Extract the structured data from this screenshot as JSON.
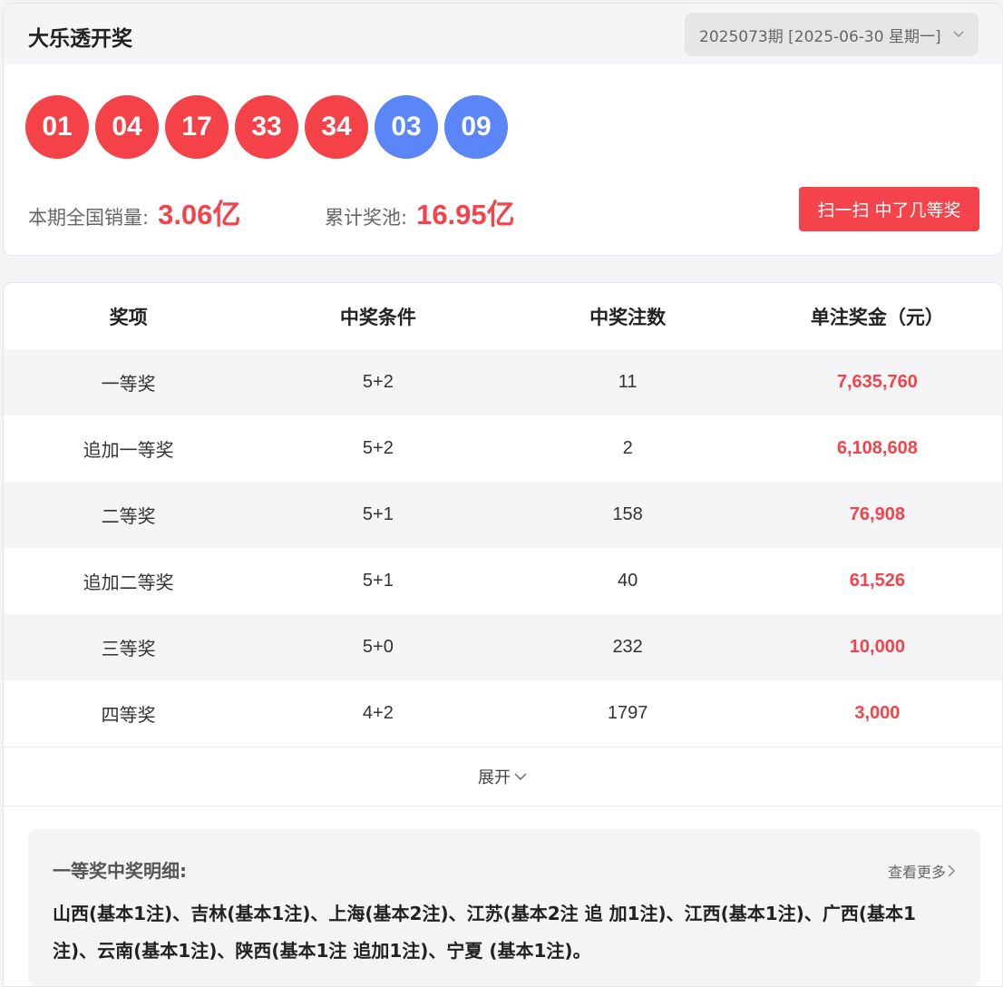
{
  "header": {
    "title": "大乐透开奖",
    "issue_select": "2025073期 [2025-06-30 星期一]"
  },
  "balls": {
    "red": [
      "01",
      "04",
      "17",
      "33",
      "34"
    ],
    "blue": [
      "03",
      "09"
    ]
  },
  "stats": {
    "sales_label": "本期全国销量:",
    "sales_value": "3.06亿",
    "pool_label": "累计奖池:",
    "pool_value": "16.95亿"
  },
  "scan_button": "扫一扫 中了几等奖",
  "table": {
    "headers": [
      "奖项",
      "中奖条件",
      "中奖注数",
      "单注奖金（元）"
    ],
    "rows": [
      {
        "name": "一等奖",
        "cond": "5+2",
        "count": "11",
        "prize": "7,635,760"
      },
      {
        "name": "追加一等奖",
        "cond": "5+2",
        "count": "2",
        "prize": "6,108,608"
      },
      {
        "name": "二等奖",
        "cond": "5+1",
        "count": "158",
        "prize": "76,908"
      },
      {
        "name": "追加二等奖",
        "cond": "5+1",
        "count": "40",
        "prize": "61,526"
      },
      {
        "name": "三等奖",
        "cond": "5+0",
        "count": "232",
        "prize": "10,000"
      },
      {
        "name": "四等奖",
        "cond": "4+2",
        "count": "1797",
        "prize": "3,000"
      }
    ]
  },
  "expand_label": "展开",
  "detail": {
    "title": "一等奖中奖明细:",
    "more": "查看更多",
    "text": "山西(基本1注)、吉林(基本1注)、上海(基本2注)、江苏(基本2注 追 加1注)、江西(基本1注)、广西(基本1注)、云南(基本1注)、陕西(基本1注 追加1注)、宁夏 (基本1注)。"
  },
  "colors": {
    "red": "#f44248",
    "blue": "#5a86f7",
    "accent": "#f4434a"
  }
}
